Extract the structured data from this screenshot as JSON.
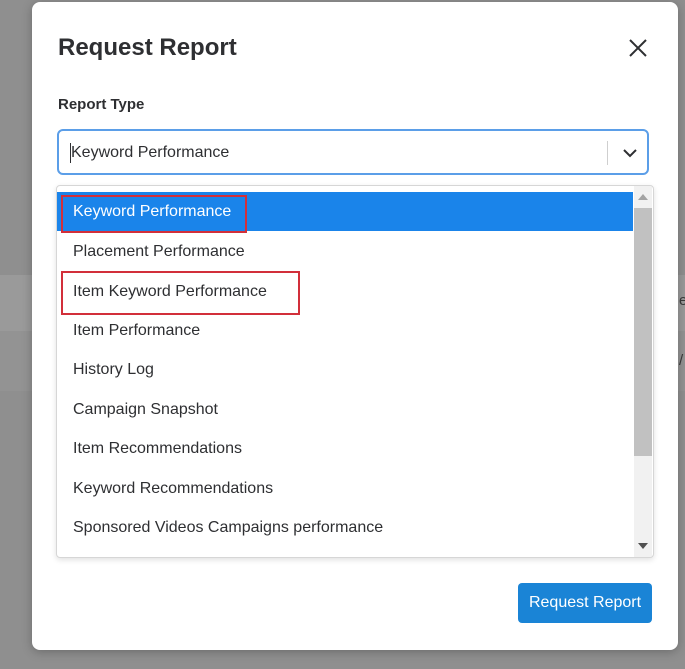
{
  "modal": {
    "title": "Request Report",
    "close_icon": "close-icon"
  },
  "report_type": {
    "label": "Report Type",
    "selected_value": "Keyword Performance",
    "chevron_icon": "chevron-down-icon"
  },
  "dropdown": {
    "options": [
      {
        "label": "Keyword Performance",
        "selected": true
      },
      {
        "label": "Placement Performance",
        "selected": false
      },
      {
        "label": "Item Keyword Performance",
        "selected": false
      },
      {
        "label": "Item Performance",
        "selected": false
      },
      {
        "label": "History Log",
        "selected": false
      },
      {
        "label": "Campaign Snapshot",
        "selected": false
      },
      {
        "label": "Item Recommendations",
        "selected": false
      },
      {
        "label": "Keyword Recommendations",
        "selected": false
      },
      {
        "label": "Sponsored Videos Campaigns performance",
        "selected": false
      }
    ]
  },
  "footer": {
    "submit_label": "Request Report"
  },
  "background": {
    "edge_text_1": "e",
    "edge_text_2": "/"
  },
  "colors": {
    "accent": "#1a84ea",
    "button": "#1a84d6",
    "annotation": "#d22f3a",
    "focus_border": "#5b9ee8"
  }
}
